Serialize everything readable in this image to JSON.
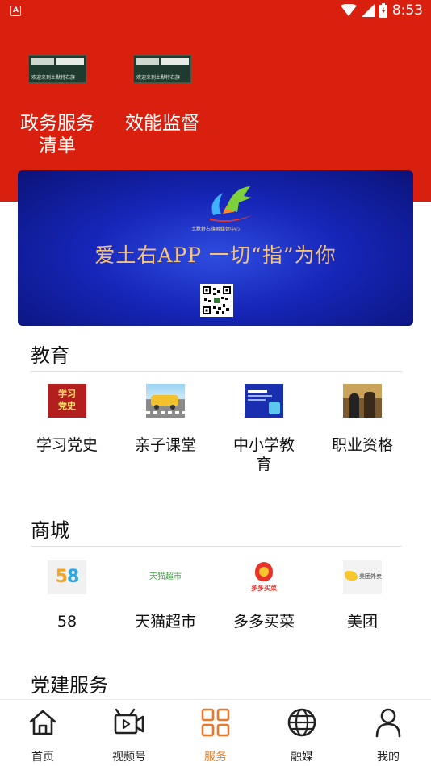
{
  "status_bar": {
    "notification_icon": "A",
    "time": "8:53"
  },
  "top_shortcuts": [
    {
      "label": "政务服务清单",
      "label_line1": "政务服务",
      "label_line2": "清单",
      "thumb_text": "欢迎来到土默特右旗"
    },
    {
      "label": "效能监督",
      "thumb_text": "欢迎来到土默特右旗"
    }
  ],
  "banner": {
    "logo_caption": "土默特右旗融媒体中心",
    "slogan": "爱土右APP 一切“指”为你"
  },
  "sections": [
    {
      "title": "教育",
      "items": [
        {
          "label": "学习党史",
          "icon_text": "学习\n党史"
        },
        {
          "label": "亲子课堂"
        },
        {
          "label": "中小学教育"
        },
        {
          "label": "职业资格"
        }
      ]
    },
    {
      "title": "商城",
      "items": [
        {
          "label": "58",
          "icon_text": "58"
        },
        {
          "label": "天猫超市",
          "icon_text": "天猫超市"
        },
        {
          "label": "多多买菜",
          "icon_text": "多多买菜"
        },
        {
          "label": "美团",
          "icon_text": "美团外卖"
        }
      ]
    },
    {
      "title": "党建服务"
    }
  ],
  "tab_bar": [
    {
      "label": "首页",
      "icon": "home-icon"
    },
    {
      "label": "视频号",
      "icon": "video-icon"
    },
    {
      "label": "服务",
      "icon": "grid-icon",
      "active": true
    },
    {
      "label": "融媒",
      "icon": "globe-icon"
    },
    {
      "label": "我的",
      "icon": "person-icon"
    }
  ],
  "colors": {
    "brand_red": "#d9200f",
    "active_tab": "#e8792b",
    "banner_blue": "#1626b9"
  }
}
